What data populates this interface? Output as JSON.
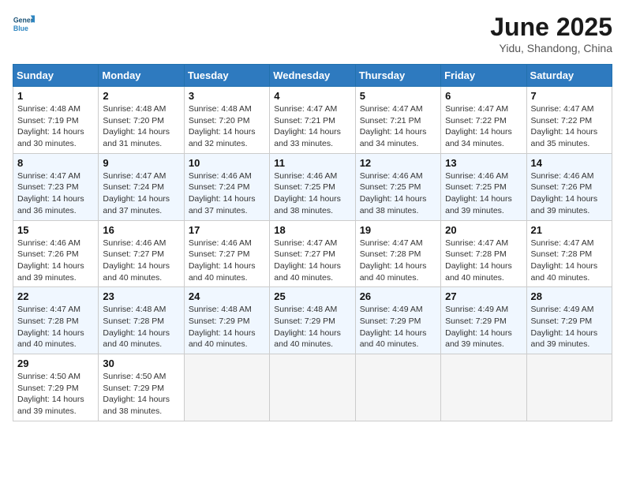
{
  "header": {
    "logo_line1": "General",
    "logo_line2": "Blue",
    "month_year": "June 2025",
    "location": "Yidu, Shandong, China"
  },
  "days_of_week": [
    "Sunday",
    "Monday",
    "Tuesday",
    "Wednesday",
    "Thursday",
    "Friday",
    "Saturday"
  ],
  "weeks": [
    [
      {
        "day": "1",
        "info": "Sunrise: 4:48 AM\nSunset: 7:19 PM\nDaylight: 14 hours\nand 30 minutes."
      },
      {
        "day": "2",
        "info": "Sunrise: 4:48 AM\nSunset: 7:20 PM\nDaylight: 14 hours\nand 31 minutes."
      },
      {
        "day": "3",
        "info": "Sunrise: 4:48 AM\nSunset: 7:20 PM\nDaylight: 14 hours\nand 32 minutes."
      },
      {
        "day": "4",
        "info": "Sunrise: 4:47 AM\nSunset: 7:21 PM\nDaylight: 14 hours\nand 33 minutes."
      },
      {
        "day": "5",
        "info": "Sunrise: 4:47 AM\nSunset: 7:21 PM\nDaylight: 14 hours\nand 34 minutes."
      },
      {
        "day": "6",
        "info": "Sunrise: 4:47 AM\nSunset: 7:22 PM\nDaylight: 14 hours\nand 34 minutes."
      },
      {
        "day": "7",
        "info": "Sunrise: 4:47 AM\nSunset: 7:22 PM\nDaylight: 14 hours\nand 35 minutes."
      }
    ],
    [
      {
        "day": "8",
        "info": "Sunrise: 4:47 AM\nSunset: 7:23 PM\nDaylight: 14 hours\nand 36 minutes."
      },
      {
        "day": "9",
        "info": "Sunrise: 4:47 AM\nSunset: 7:24 PM\nDaylight: 14 hours\nand 37 minutes."
      },
      {
        "day": "10",
        "info": "Sunrise: 4:46 AM\nSunset: 7:24 PM\nDaylight: 14 hours\nand 37 minutes."
      },
      {
        "day": "11",
        "info": "Sunrise: 4:46 AM\nSunset: 7:25 PM\nDaylight: 14 hours\nand 38 minutes."
      },
      {
        "day": "12",
        "info": "Sunrise: 4:46 AM\nSunset: 7:25 PM\nDaylight: 14 hours\nand 38 minutes."
      },
      {
        "day": "13",
        "info": "Sunrise: 4:46 AM\nSunset: 7:25 PM\nDaylight: 14 hours\nand 39 minutes."
      },
      {
        "day": "14",
        "info": "Sunrise: 4:46 AM\nSunset: 7:26 PM\nDaylight: 14 hours\nand 39 minutes."
      }
    ],
    [
      {
        "day": "15",
        "info": "Sunrise: 4:46 AM\nSunset: 7:26 PM\nDaylight: 14 hours\nand 39 minutes."
      },
      {
        "day": "16",
        "info": "Sunrise: 4:46 AM\nSunset: 7:27 PM\nDaylight: 14 hours\nand 40 minutes."
      },
      {
        "day": "17",
        "info": "Sunrise: 4:46 AM\nSunset: 7:27 PM\nDaylight: 14 hours\nand 40 minutes."
      },
      {
        "day": "18",
        "info": "Sunrise: 4:47 AM\nSunset: 7:27 PM\nDaylight: 14 hours\nand 40 minutes."
      },
      {
        "day": "19",
        "info": "Sunrise: 4:47 AM\nSunset: 7:28 PM\nDaylight: 14 hours\nand 40 minutes."
      },
      {
        "day": "20",
        "info": "Sunrise: 4:47 AM\nSunset: 7:28 PM\nDaylight: 14 hours\nand 40 minutes."
      },
      {
        "day": "21",
        "info": "Sunrise: 4:47 AM\nSunset: 7:28 PM\nDaylight: 14 hours\nand 40 minutes."
      }
    ],
    [
      {
        "day": "22",
        "info": "Sunrise: 4:47 AM\nSunset: 7:28 PM\nDaylight: 14 hours\nand 40 minutes."
      },
      {
        "day": "23",
        "info": "Sunrise: 4:48 AM\nSunset: 7:28 PM\nDaylight: 14 hours\nand 40 minutes."
      },
      {
        "day": "24",
        "info": "Sunrise: 4:48 AM\nSunset: 7:29 PM\nDaylight: 14 hours\nand 40 minutes."
      },
      {
        "day": "25",
        "info": "Sunrise: 4:48 AM\nSunset: 7:29 PM\nDaylight: 14 hours\nand 40 minutes."
      },
      {
        "day": "26",
        "info": "Sunrise: 4:49 AM\nSunset: 7:29 PM\nDaylight: 14 hours\nand 40 minutes."
      },
      {
        "day": "27",
        "info": "Sunrise: 4:49 AM\nSunset: 7:29 PM\nDaylight: 14 hours\nand 39 minutes."
      },
      {
        "day": "28",
        "info": "Sunrise: 4:49 AM\nSunset: 7:29 PM\nDaylight: 14 hours\nand 39 minutes."
      }
    ],
    [
      {
        "day": "29",
        "info": "Sunrise: 4:50 AM\nSunset: 7:29 PM\nDaylight: 14 hours\nand 39 minutes."
      },
      {
        "day": "30",
        "info": "Sunrise: 4:50 AM\nSunset: 7:29 PM\nDaylight: 14 hours\nand 38 minutes."
      },
      {
        "day": "",
        "info": ""
      },
      {
        "day": "",
        "info": ""
      },
      {
        "day": "",
        "info": ""
      },
      {
        "day": "",
        "info": ""
      },
      {
        "day": "",
        "info": ""
      }
    ]
  ]
}
